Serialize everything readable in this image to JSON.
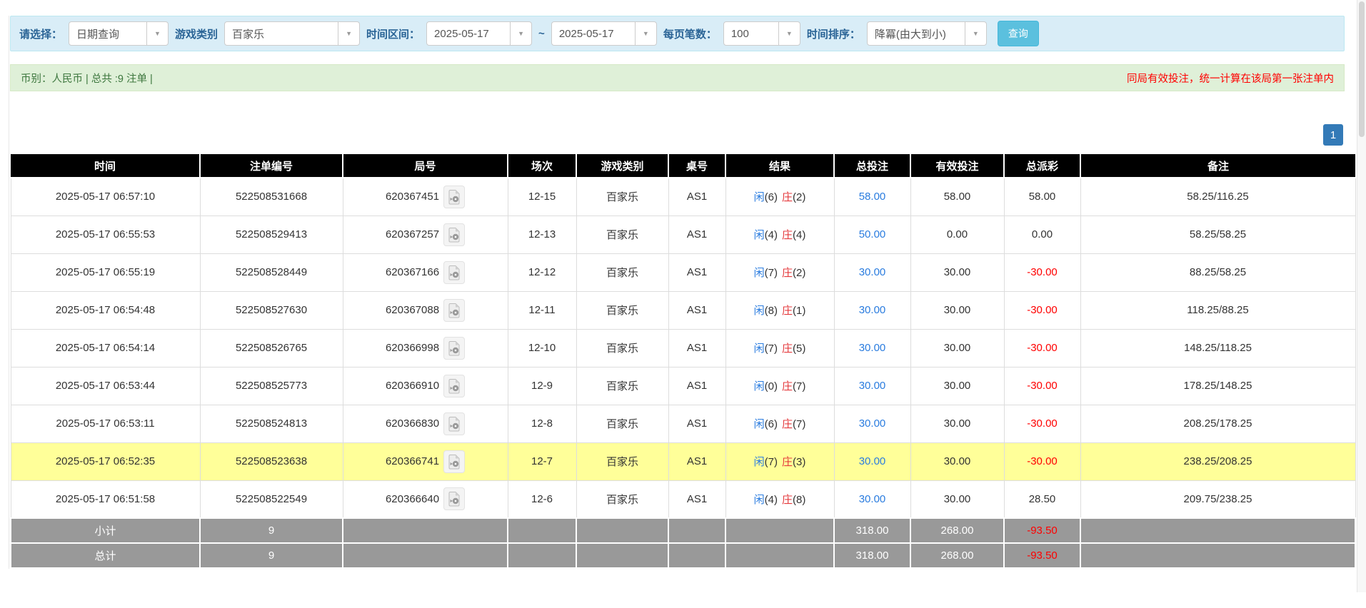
{
  "filters": {
    "select_label": "请选择：",
    "query_type_value": "日期查询",
    "game_category_label": "游戏类别",
    "game_category_value": "百家乐",
    "time_range_label": "时间区间：",
    "date_from": "2025-05-17",
    "tilde": "~",
    "date_to": "2025-05-17",
    "page_size_label": "每页笔数：",
    "page_size_value": "100",
    "sort_label": "时间排序：",
    "sort_value": "降冪(由大到小)",
    "search_button": "查询"
  },
  "summary_bar": {
    "left": "币别：人民币 | 总共 :9 注单 |",
    "right": "同局有效投注，统一计算在该局第一张注单内"
  },
  "pagination": {
    "page": "1"
  },
  "colors": {
    "accent_blue": "#2a7cdf",
    "banker_red": "#e4393c",
    "negative_red": "#ff0000",
    "highlight_yellow": "#ffff99",
    "header_bg": "#000000",
    "sum_row_bg": "#999999",
    "filter_bar_bg": "#d9edf7",
    "summary_bar_bg": "#dff0d8",
    "search_button_bg": "#5bc0de",
    "page_button_bg": "#337ab7"
  },
  "table": {
    "headers": [
      "时间",
      "注单编号",
      "局号",
      "场次",
      "游戏类别",
      "桌号",
      "结果",
      "总投注",
      "有效投注",
      "总派彩",
      "备注"
    ],
    "rows": [
      {
        "time": "2025-05-17 06:57:10",
        "bet_id": "522508531668",
        "round_id": "620367451",
        "session": "12-15",
        "game": "百家乐",
        "table_no": "AS1",
        "result_player_label": "闲",
        "result_player_num": "(6)",
        "result_banker_label": "庄",
        "result_banker_num": "(2)",
        "total_bet": "58.00",
        "valid_bet": "58.00",
        "payout": "58.00",
        "payout_red": false,
        "remark": "58.25/116.25",
        "highlight": false
      },
      {
        "time": "2025-05-17 06:55:53",
        "bet_id": "522508529413",
        "round_id": "620367257",
        "session": "12-13",
        "game": "百家乐",
        "table_no": "AS1",
        "result_player_label": "闲",
        "result_player_num": "(4)",
        "result_banker_label": "庄",
        "result_banker_num": "(4)",
        "total_bet": "50.00",
        "valid_bet": "0.00",
        "payout": "0.00",
        "payout_red": false,
        "remark": "58.25/58.25",
        "highlight": false
      },
      {
        "time": "2025-05-17 06:55:19",
        "bet_id": "522508528449",
        "round_id": "620367166",
        "session": "12-12",
        "game": "百家乐",
        "table_no": "AS1",
        "result_player_label": "闲",
        "result_player_num": "(7)",
        "result_banker_label": "庄",
        "result_banker_num": "(2)",
        "total_bet": "30.00",
        "valid_bet": "30.00",
        "payout": "-30.00",
        "payout_red": true,
        "remark": "88.25/58.25",
        "highlight": false
      },
      {
        "time": "2025-05-17 06:54:48",
        "bet_id": "522508527630",
        "round_id": "620367088",
        "session": "12-11",
        "game": "百家乐",
        "table_no": "AS1",
        "result_player_label": "闲",
        "result_player_num": "(8)",
        "result_banker_label": "庄",
        "result_banker_num": "(1)",
        "total_bet": "30.00",
        "valid_bet": "30.00",
        "payout": "-30.00",
        "payout_red": true,
        "remark": "118.25/88.25",
        "highlight": false
      },
      {
        "time": "2025-05-17 06:54:14",
        "bet_id": "522508526765",
        "round_id": "620366998",
        "session": "12-10",
        "game": "百家乐",
        "table_no": "AS1",
        "result_player_label": "闲",
        "result_player_num": "(7)",
        "result_banker_label": "庄",
        "result_banker_num": "(5)",
        "total_bet": "30.00",
        "valid_bet": "30.00",
        "payout": "-30.00",
        "payout_red": true,
        "remark": "148.25/118.25",
        "highlight": false
      },
      {
        "time": "2025-05-17 06:53:44",
        "bet_id": "522508525773",
        "round_id": "620366910",
        "session": "12-9",
        "game": "百家乐",
        "table_no": "AS1",
        "result_player_label": "闲",
        "result_player_num": "(0)",
        "result_banker_label": "庄",
        "result_banker_num": "(7)",
        "total_bet": "30.00",
        "valid_bet": "30.00",
        "payout": "-30.00",
        "payout_red": true,
        "remark": "178.25/148.25",
        "highlight": false
      },
      {
        "time": "2025-05-17 06:53:11",
        "bet_id": "522508524813",
        "round_id": "620366830",
        "session": "12-8",
        "game": "百家乐",
        "table_no": "AS1",
        "result_player_label": "闲",
        "result_player_num": "(6)",
        "result_banker_label": "庄",
        "result_banker_num": "(7)",
        "total_bet": "30.00",
        "valid_bet": "30.00",
        "payout": "-30.00",
        "payout_red": true,
        "remark": "208.25/178.25",
        "highlight": false
      },
      {
        "time": "2025-05-17 06:52:35",
        "bet_id": "522508523638",
        "round_id": "620366741",
        "session": "12-7",
        "game": "百家乐",
        "table_no": "AS1",
        "result_player_label": "闲",
        "result_player_num": "(7)",
        "result_banker_label": "庄",
        "result_banker_num": "(3)",
        "total_bet": "30.00",
        "valid_bet": "30.00",
        "payout": "-30.00",
        "payout_red": true,
        "remark": "238.25/208.25",
        "highlight": true
      },
      {
        "time": "2025-05-17 06:51:58",
        "bet_id": "522508522549",
        "round_id": "620366640",
        "session": "12-6",
        "game": "百家乐",
        "table_no": "AS1",
        "result_player_label": "闲",
        "result_player_num": "(4)",
        "result_banker_label": "庄",
        "result_banker_num": "(8)",
        "total_bet": "30.00",
        "valid_bet": "30.00",
        "payout": "28.50",
        "payout_red": false,
        "remark": "209.75/238.25",
        "highlight": false
      }
    ],
    "subtotal": {
      "label": "小计",
      "count": "9",
      "total_bet": "318.00",
      "valid_bet": "268.00",
      "payout": "-93.50"
    },
    "total": {
      "label": "总计",
      "count": "9",
      "total_bet": "318.00",
      "valid_bet": "268.00",
      "payout": "-93.50"
    }
  }
}
